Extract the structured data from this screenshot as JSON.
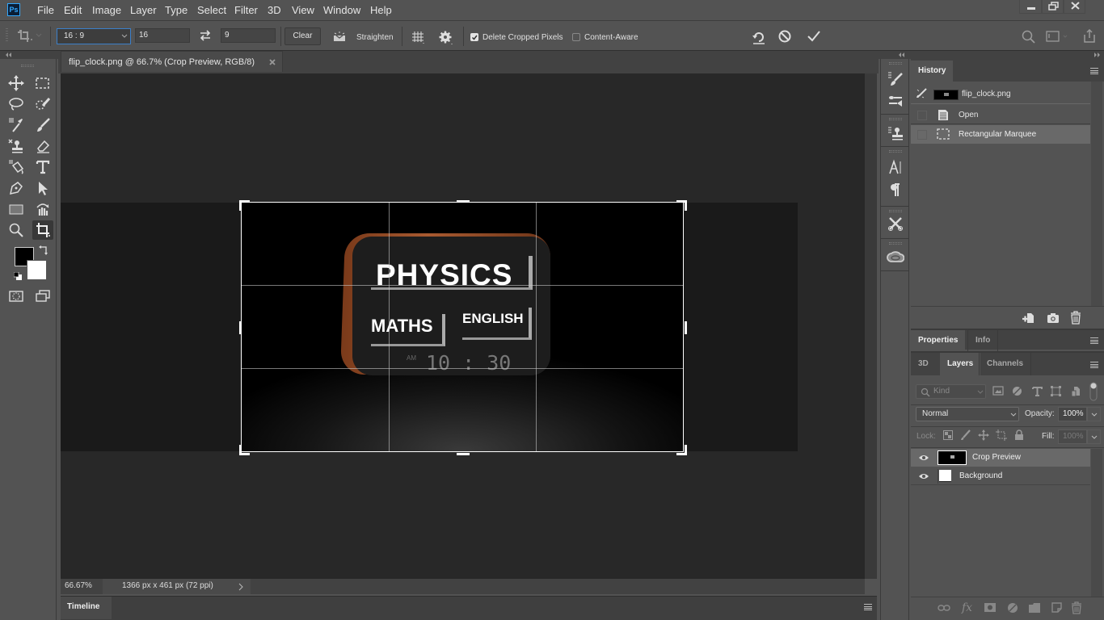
{
  "app": {
    "logo": "Ps",
    "menu": [
      "File",
      "Edit",
      "Image",
      "Layer",
      "Type",
      "Select",
      "Filter",
      "3D",
      "View",
      "Window",
      "Help"
    ],
    "window_controls": [
      "minimize",
      "restore",
      "close"
    ]
  },
  "options_bar": {
    "ratio_preset": "16 : 9",
    "width_value": "16",
    "height_value": "9",
    "clear_label": "Clear",
    "straighten_label": "Straighten",
    "delete_cropped_label": "Delete Cropped Pixels",
    "delete_cropped_checked": true,
    "content_aware_label": "Content-Aware",
    "content_aware_checked": false
  },
  "document": {
    "tab_title": "flip_clock.png @ 66.7% (Crop Preview, RGB/8)",
    "zoom_level": "66.67%",
    "doc_info": "1366 px x 461 px (72 ppi)",
    "image_text": {
      "line1": "PHYSICS",
      "line2a": "MATHS",
      "line2b": "ENGLISH",
      "ampm": "AM",
      "time": "10 : 30"
    }
  },
  "timeline": {
    "label": "Timeline"
  },
  "toolbar": {
    "tools": [
      "move",
      "rectangular-marquee",
      "lasso",
      "quick-selection",
      "eyedropper",
      "brush",
      "clone-stamp",
      "eraser",
      "paint-bucket",
      "type",
      "pen",
      "path-selection",
      "rectangle",
      "hand-rotate",
      "zoom",
      "crop",
      "quick-mask",
      "screen-mode"
    ],
    "active_tool": "crop"
  },
  "history_panel": {
    "tab": "History",
    "snapshot": "flip_clock.png",
    "items": [
      {
        "label": "Open",
        "icon": "document-icon"
      },
      {
        "label": "Rectangular Marquee",
        "icon": "marquee-icon",
        "selected": true
      }
    ]
  },
  "properties_panel": {
    "tabs": [
      "Properties",
      "Info"
    ],
    "active": "Properties"
  },
  "layers_panel": {
    "tabs": [
      "3D",
      "Layers",
      "Channels"
    ],
    "active": "Layers",
    "filter_placeholder": "Kind",
    "blend_mode": "Normal",
    "opacity_label": "Opacity:",
    "opacity_value": "100%",
    "lock_label": "Lock:",
    "fill_label": "Fill:",
    "fill_value": "100%",
    "layers": [
      {
        "name": "Crop Preview",
        "visible": true,
        "selected": true
      },
      {
        "name": "Background",
        "visible": true,
        "selected": false
      }
    ]
  },
  "colors": {
    "ui_bg": "#535353",
    "canvas_bg": "#282828",
    "accent": "#31a8ff",
    "selected_row": "#696969"
  }
}
